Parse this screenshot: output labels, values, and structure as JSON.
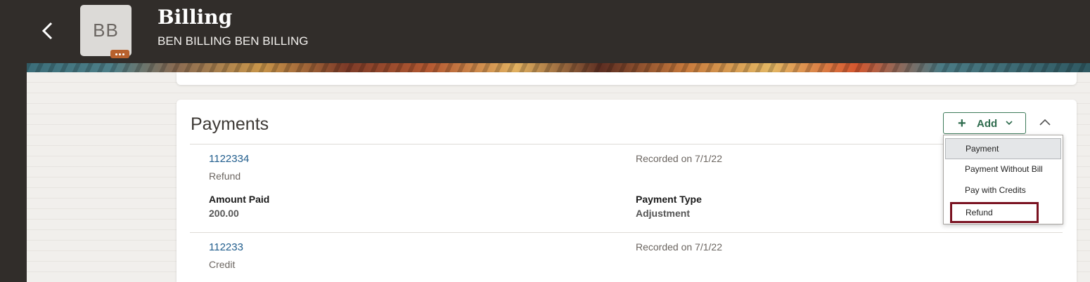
{
  "header": {
    "title": "Billing",
    "subtitle": "BEN BILLING BEN BILLING",
    "avatar_initials": "BB",
    "icons": {
      "back": "chevron-left-icon",
      "more": "more-dots-icon"
    }
  },
  "payments": {
    "title": "Payments",
    "add_label": "Add",
    "add_menu": [
      "Payment",
      "Payment Without Bill",
      "Pay with Credits",
      "Refund"
    ],
    "rows": [
      {
        "id": "1122334",
        "kind": "Refund",
        "recorded": "Recorded on 7/1/22",
        "amount_label": "Amount Paid",
        "amount": "200.00",
        "type_label": "Payment Type",
        "type": "Adjustment"
      },
      {
        "id": "112233",
        "kind": "Credit",
        "recorded": "Recorded on 7/1/22"
      }
    ]
  },
  "colors": {
    "topbar": "#312d2a",
    "link": "#1f5c8c",
    "add_button": "#2e6b4d",
    "highlight_border": "#7a1221"
  }
}
